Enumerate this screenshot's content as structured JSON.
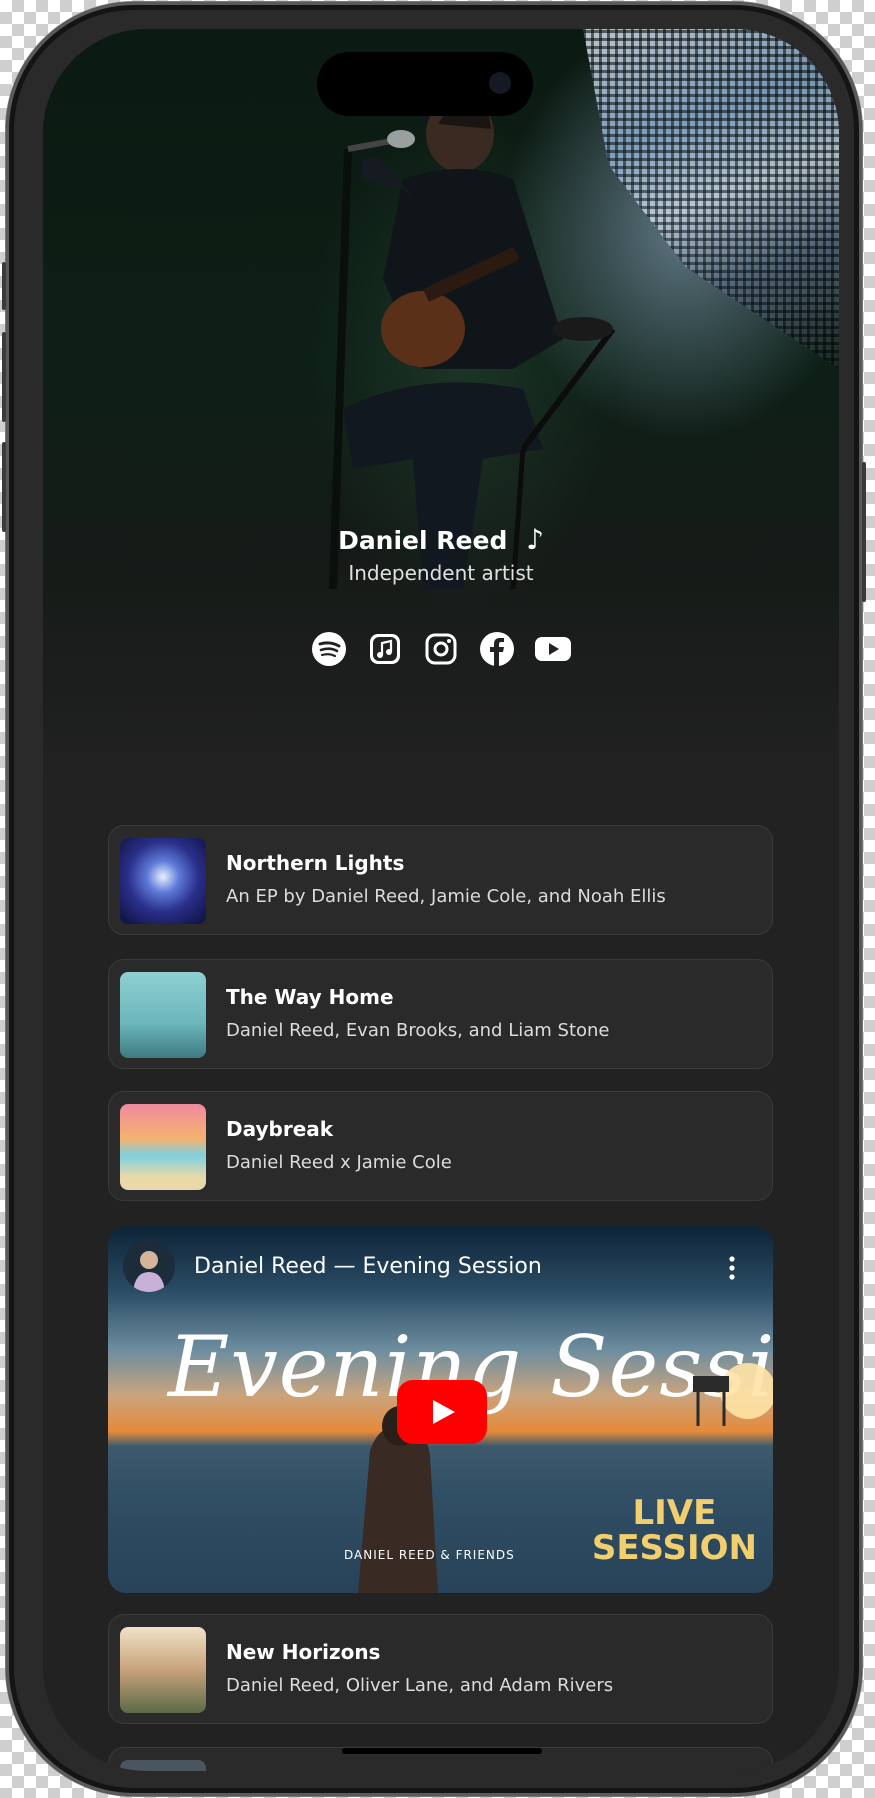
{
  "artist": {
    "name": "Daniel Reed",
    "music_note": "♪",
    "subtitle": "Independent artist"
  },
  "social_links": [
    {
      "name": "spotify-icon"
    },
    {
      "name": "apple-music-icon"
    },
    {
      "name": "instagram-icon"
    },
    {
      "name": "facebook-icon"
    },
    {
      "name": "youtube-icon"
    }
  ],
  "releases": [
    {
      "title": "Northern Lights",
      "subtitle": "An EP by Daniel Reed, Jamie Cole, and Noah Ellis"
    },
    {
      "title": "The Way Home",
      "subtitle": "Daniel Reed, Evan Brooks, and Liam Stone"
    },
    {
      "title": "Daybreak",
      "subtitle": "Daniel Reed x Jamie Cole"
    },
    {
      "title": "New Horizons",
      "subtitle": "Daniel Reed, Oliver Lane, and Adam Rivers"
    }
  ],
  "video": {
    "title": "Daniel Reed — Evening Session",
    "script_text": "Evening Session",
    "badge_line1": "LIVE",
    "badge_line2": "SESSION",
    "credit": "DANIEL REED & FRIENDS"
  },
  "colors": {
    "background": "#222222",
    "card": "#2a2a2a",
    "youtube_red": "#ff0000",
    "live_badge": "#f2cf6e"
  }
}
